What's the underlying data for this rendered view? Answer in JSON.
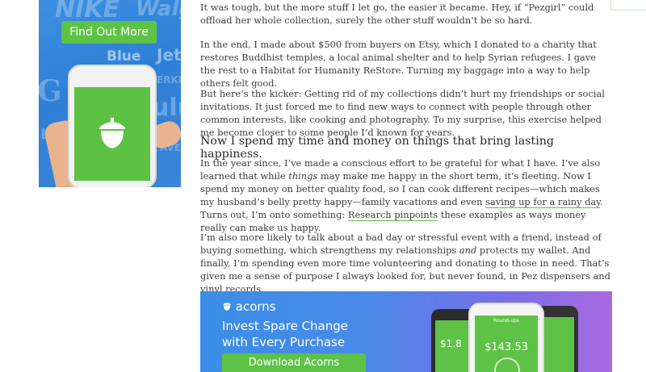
{
  "side_ad": {
    "brand_texts": [
      "NIKE",
      "Walg",
      "Blue",
      "Jet",
      "ERKER",
      "G A",
      "ulu",
      "AVE",
      "LU"
    ],
    "button_label": "Find Out More"
  },
  "article": {
    "p1": "It was tough, but the more stuff I let go, the easier it became. Hey, if “Pezgirl” could offload her whole collection, surely the other stuff wouldn’t be so hard.",
    "p2": "In the end, I made about $500 from buyers on Etsy, which I donated to a charity that restores Buddhist temples, a local animal shelter and to help Syrian refugees. I gave the rest to a Habitat for Humanity ReStore. Turning my baggage into a way to help others felt good.",
    "p3": "But here’s the kicker: Getting rid of my collections didn’t hurt my friendships or social invitations. It just forced me to find new ways to connect with people through other common interests, like cooking and photography. To my surprise, this exercise helped me become closer to some people I’d known for years.",
    "heading": "Now I spend my time and money on things that bring lasting happiness.",
    "p4": {
      "a": "In the year since, I’ve made a conscious effort to be grateful for what I have. I’ve also learned that while ",
      "em": "things",
      "b": " may make me happy in the short term, it’s fleeting. Now I spend my money on better quality food, so I can cook different recipes—which makes my husband’s belly pretty happy—family vacations and even ",
      "link1": "saving up for a rainy day",
      "c": ". Turns out, I’m onto something: ",
      "link2": "Research pinpoints",
      "d": " these examples as ways money really can make us happy."
    },
    "p5": {
      "a": "I’m also more likely to talk about a bad day or stressful event with a friend, instead of buying something, which strengthens my relationships ",
      "em": "and",
      "b": " protects my wallet. And finally, I’m spending even more time volunteering and donating to those in need. That’s given me a sense of purpose I always looked for, but never found, in Pez dispensers and vinyl records."
    }
  },
  "bottom_ad": {
    "logo": "acorns",
    "headline_line1": "Invest Spare Change",
    "headline_line2": "with Every Purchase",
    "button_label": "Download Acorns",
    "phone_title": "Round-ups",
    "phone_amount": "$143.53",
    "left_phone_amount": "$1.8",
    "colors": {
      "green": "#5ec246",
      "blue": "#3a8ee6",
      "purple": "#a86ae0"
    }
  }
}
